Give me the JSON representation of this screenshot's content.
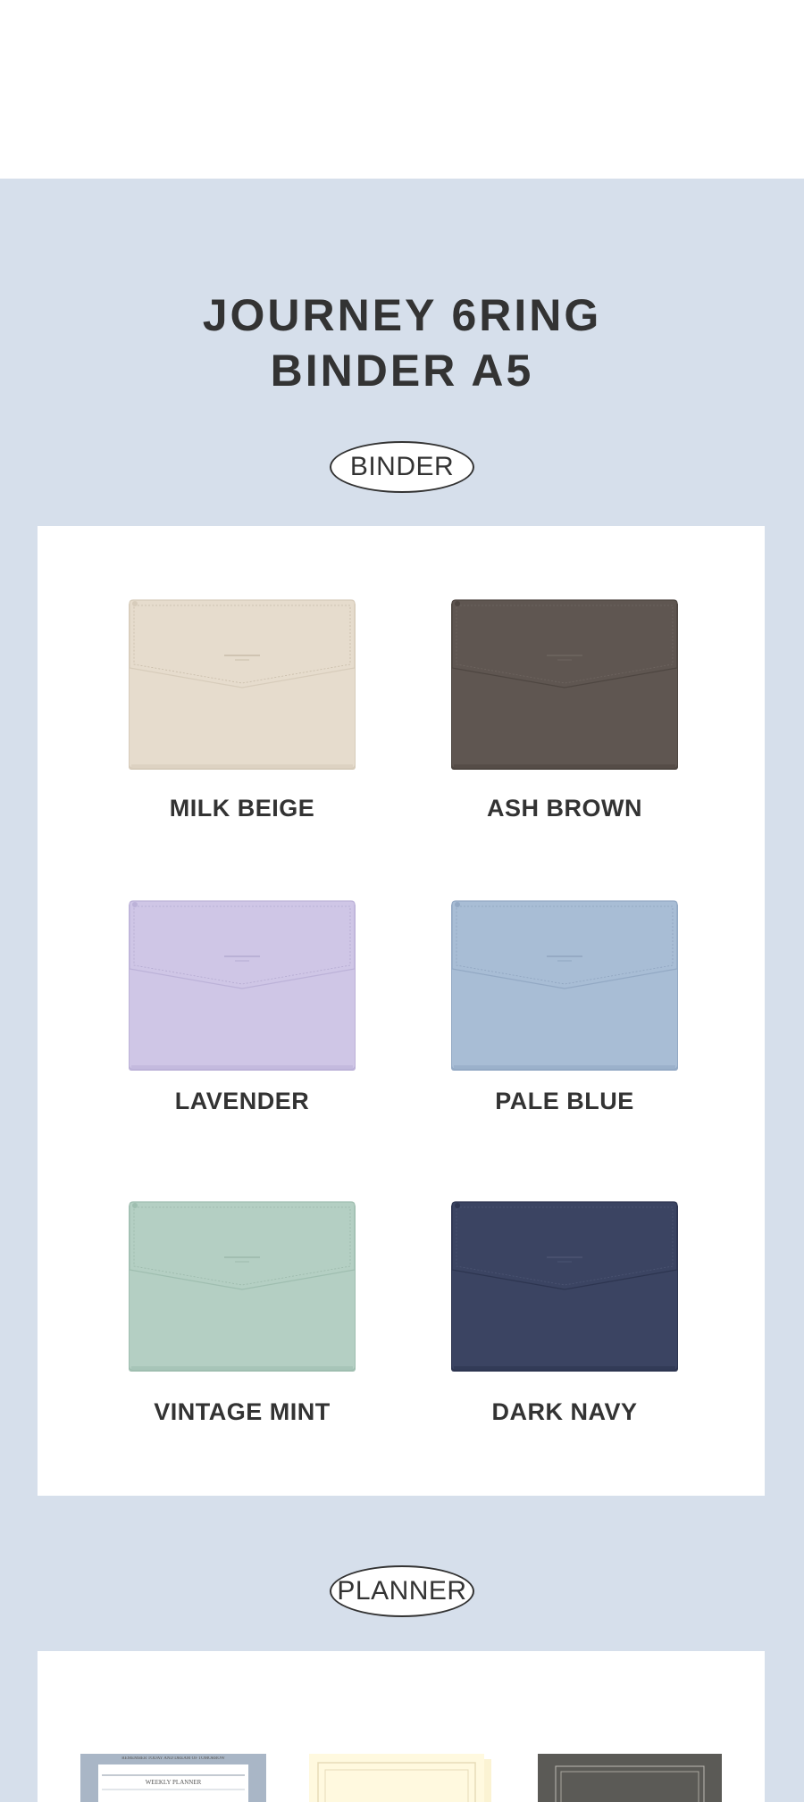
{
  "title": {
    "line1": "JOURNEY 6RING",
    "line2": "BINDER A5"
  },
  "sections": {
    "binder_label": "BINDER",
    "planner_label": "PLANNER"
  },
  "binders": [
    {
      "name": "MILK BEIGE",
      "color": "#e6dccd",
      "edge": "#d7ccbb",
      "stitch": "#c8bca9"
    },
    {
      "name": "ASH BROWN",
      "color": "#5f5651",
      "edge": "#4e4641",
      "stitch": "#6f6661"
    },
    {
      "name": "LAVENDER",
      "color": "#cfc6e6",
      "edge": "#bcb2d8",
      "stitch": "#b4aad0"
    },
    {
      "name": "PALE BLUE",
      "color": "#a8bdd5",
      "edge": "#93a9c4",
      "stitch": "#8fa4bf"
    },
    {
      "name": "VINTAGE MINT",
      "color": "#b4cfc3",
      "edge": "#9fbeb0",
      "stitch": "#9cb9ab"
    },
    {
      "name": "DARK NAVY",
      "color": "#3b4462",
      "edge": "#2d3550",
      "stitch": "#4c5573"
    }
  ],
  "planner_preview": {
    "card1_text": "WEEKLY PLANNER",
    "card1_header": "REMEMBER TODAY AND DREAM OF TOMORROW"
  }
}
